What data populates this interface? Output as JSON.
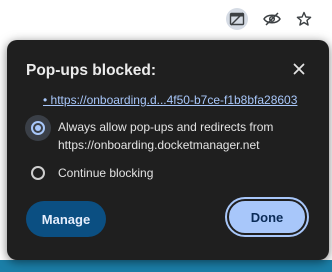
{
  "browser": {
    "icons": [
      "popup-blocked-icon",
      "eye-slash-icon",
      "star-icon"
    ]
  },
  "popup": {
    "title": "Pop-ups blocked:",
    "close_icon": "close-icon",
    "blocked_links": [
      "https://onboarding.d...4f50-b7ce-f1b8bfa28603"
    ],
    "options": [
      {
        "label": "Always allow pop-ups and redirects from https://onboarding.docketmanager.net",
        "selected": true
      },
      {
        "label": "Continue blocking",
        "selected": false
      }
    ],
    "buttons": {
      "manage": "Manage",
      "done": "Done"
    }
  },
  "colors": {
    "popup_bg": "#1f1f1f",
    "link": "#a8c7fa",
    "manage_bg": "#0b4f82",
    "done_bg": "#a8c7fa"
  }
}
